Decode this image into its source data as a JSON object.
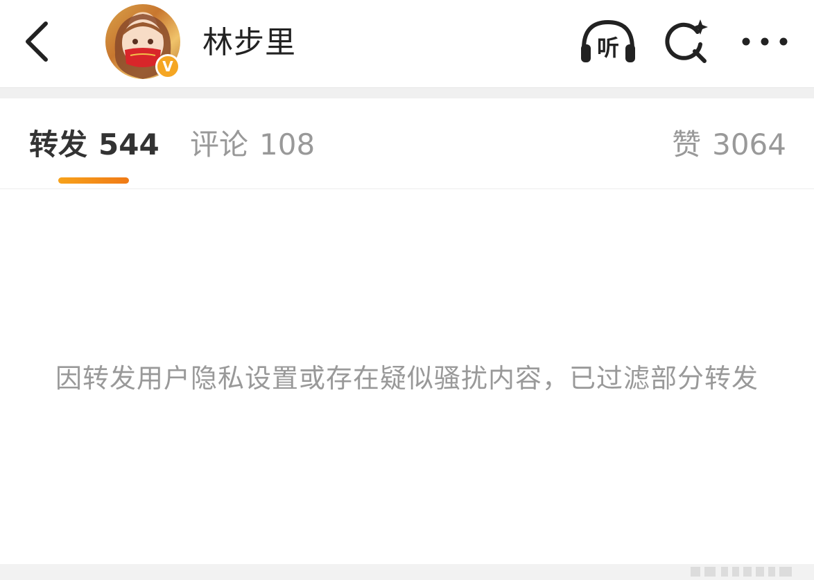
{
  "header": {
    "back_icon": "chevron-left-icon",
    "username": "林步里",
    "verified_badge": "V",
    "listen_label": "听",
    "listen_icon": "headphones-icon",
    "search_icon": "search-sparkle-icon",
    "more_icon": "more-dots-icon"
  },
  "tabs": [
    {
      "label": "转发",
      "count": "544",
      "active": true
    },
    {
      "label": "评论",
      "count": "108",
      "active": false
    },
    {
      "label": "赞",
      "count": "3064",
      "active": false
    }
  ],
  "notice": "因转发用户隐私设置或存在疑似骚扰内容，已过滤部分转发",
  "colors": {
    "accent": "#F7A21B",
    "active_tab_text": "#333333",
    "inactive_tab_text": "#999999",
    "badge": "#F5A623"
  }
}
